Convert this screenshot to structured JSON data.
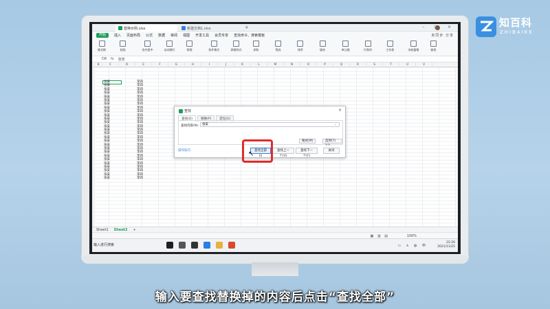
{
  "brand": {
    "cn": "知百科",
    "en": "ZHIBAIKE"
  },
  "window": {
    "tabs": [
      {
        "label": "替换示例.xlsx",
        "active": true
      },
      {
        "label": "新建文档1.xlsx",
        "active": false
      }
    ]
  },
  "menu": {
    "items": [
      "开始",
      "插入",
      "页面布局",
      "公式",
      "数据",
      "审阅",
      "视图",
      "开发工具",
      "会员专享"
    ],
    "search": "查找命令、搜索模板",
    "right": "未同步 分享"
  },
  "ribbon": {
    "groups": [
      "格式刷",
      "粘贴",
      "合并居中",
      "自动换行",
      "常规",
      "条件格式",
      "表格样式",
      "求和",
      "筛选",
      "排序",
      "填充",
      "单元格",
      "行和列",
      "工作表",
      "冻结窗格",
      "查找"
    ]
  },
  "formula_bar": {
    "cell_ref": "D8",
    "fx": "fx",
    "value": "张安"
  },
  "columns": [
    "B",
    "C",
    "D",
    "E",
    "F",
    "G",
    "H",
    "I",
    "J",
    "K",
    "L",
    "M",
    "N",
    "O",
    "P",
    "Q",
    "R",
    "S",
    "T",
    "U",
    "V"
  ],
  "cells": [
    [
      "张安",
      "李四"
    ],
    [
      "张安",
      "李四"
    ],
    [
      "张安",
      "李四"
    ],
    [
      "张安",
      "李四"
    ],
    [
      "张安",
      "李四"
    ],
    [
      "张安",
      "李四"
    ],
    [
      "张安",
      "李四"
    ],
    [
      "张安",
      "李四"
    ],
    [
      "张安",
      "李四"
    ],
    [
      "张安",
      "李四"
    ],
    [
      "张安",
      "李四"
    ],
    [
      "张安",
      "李四"
    ],
    [
      "张安",
      "李四"
    ],
    [
      "张安",
      "李四"
    ],
    [
      "张安",
      "李四"
    ],
    [
      "张安",
      "李四"
    ],
    [
      "张安",
      "李四"
    ],
    [
      "张安",
      "李四"
    ],
    [
      "张安",
      "李四"
    ],
    [
      "张安",
      "李四"
    ],
    [
      "张安",
      "李四"
    ],
    [
      "张安",
      "李四"
    ],
    [
      "张安",
      "李四"
    ],
    [
      "张安",
      "李四"
    ],
    [
      "张安",
      "李四"
    ],
    [
      "张安",
      "李四"
    ],
    [
      "张安",
      "李四"
    ]
  ],
  "sheets": {
    "tab1": "Sheet1",
    "tab2": "Sheet2",
    "add": "+"
  },
  "status": {
    "zoom": "100%",
    "left": "输入进行搜索"
  },
  "taskbar": {
    "time": "22:26",
    "date": "2021/11/25"
  },
  "dialog": {
    "title": "查找",
    "tabs": [
      "查找(D)",
      "替换(P)",
      "定位(G)"
    ],
    "label": "查找内容(N):",
    "value": "张安",
    "opt1": "格式(M)",
    "opt2": "选项(T) >>",
    "help": "操作技巧",
    "btn_find_all": "查找全部(I)",
    "btn_prev": "查找上一个(V)",
    "btn_next": "查找下一个(F)",
    "btn_close": "关闭"
  },
  "caption": "输入要查找替换掉的内容后点击“查找全部”"
}
